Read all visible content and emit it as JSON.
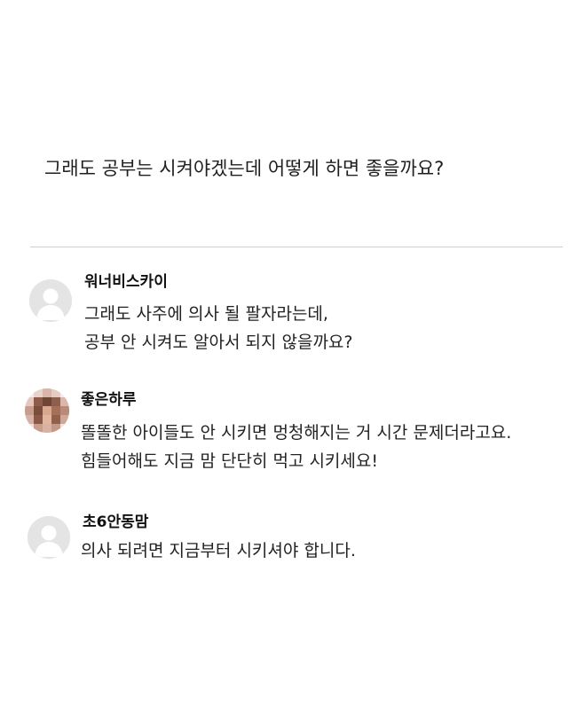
{
  "question": "그래도 공부는 시켜야겠는데 어떻게 하면 좋을까요?",
  "comments": [
    {
      "author": "워너비스카이",
      "avatar": "default-user-icon",
      "lines": [
        "그래도 사주에 의사 될 팔자라는데,",
        "공부 안 시켜도 알아서 되지 않을까요?"
      ]
    },
    {
      "author": "좋은하루",
      "avatar": "pixelated-photo",
      "lines": [
        "똘똘한 아이들도 안 시키면 멍청해지는 거 시간 문제더라고요.",
        "힘들어해도 지금 맘 단단히 먹고 시키세요!"
      ]
    },
    {
      "author": "초6안동맘",
      "avatar": "default-user-icon",
      "lines": [
        "의사 되려면 지금부터 시키셔야 합니다."
      ]
    }
  ]
}
